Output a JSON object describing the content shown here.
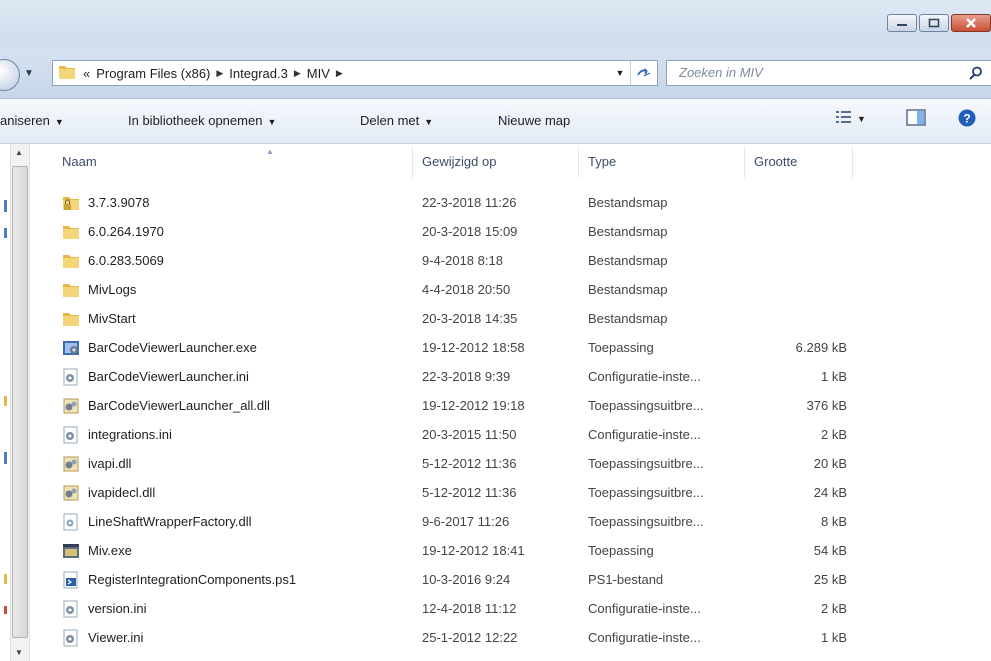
{
  "window": {
    "buttons": [
      "minimize",
      "maximize",
      "close"
    ]
  },
  "address": {
    "overflow": "«",
    "crumbs": [
      "Program Files (x86)",
      "Integrad.3",
      "MIV"
    ],
    "search_placeholder": "Zoeken in MIV"
  },
  "toolbar": {
    "organize": "aniseren",
    "include_library": "In bibliotheek opnemen",
    "share_with": "Delen met",
    "new_folder": "Nieuwe map"
  },
  "columns": {
    "name": "Naam",
    "modified": "Gewijzigd op",
    "type": "Type",
    "size": "Grootte"
  },
  "files": [
    {
      "icon": "locked-folder-icon",
      "name": "3.7.3.9078",
      "modified": "22-3-2018 11:26",
      "type": "Bestandsmap",
      "size": ""
    },
    {
      "icon": "folder-icon",
      "name": "6.0.264.1970",
      "modified": "20-3-2018 15:09",
      "type": "Bestandsmap",
      "size": ""
    },
    {
      "icon": "folder-icon",
      "name": "6.0.283.5069",
      "modified": "9-4-2018 8:18",
      "type": "Bestandsmap",
      "size": ""
    },
    {
      "icon": "folder-icon",
      "name": "MivLogs",
      "modified": "4-4-2018 20:50",
      "type": "Bestandsmap",
      "size": ""
    },
    {
      "icon": "folder-icon",
      "name": "MivStart",
      "modified": "20-3-2018 14:35",
      "type": "Bestandsmap",
      "size": ""
    },
    {
      "icon": "exe-icon",
      "name": "BarCodeViewerLauncher.exe",
      "modified": "19-12-2012 18:58",
      "type": "Toepassing",
      "size": "6.289 kB"
    },
    {
      "icon": "config-file-icon",
      "name": "BarCodeViewerLauncher.ini",
      "modified": "22-3-2018 9:39",
      "type": "Configuratie-inste...",
      "size": "1 kB"
    },
    {
      "icon": "dll-icon",
      "name": "BarCodeViewerLauncher_all.dll",
      "modified": "19-12-2012 19:18",
      "type": "Toepassingsuitbre...",
      "size": "376 kB"
    },
    {
      "icon": "config-file-icon",
      "name": "integrations.ini",
      "modified": "20-3-2015 11:50",
      "type": "Configuratie-inste...",
      "size": "2 kB"
    },
    {
      "icon": "dll-icon",
      "name": "ivapi.dll",
      "modified": "5-12-2012 11:36",
      "type": "Toepassingsuitbre...",
      "size": "20 kB"
    },
    {
      "icon": "dll-icon",
      "name": "ivapidecl.dll",
      "modified": "5-12-2012 11:36",
      "type": "Toepassingsuitbre...",
      "size": "24 kB"
    },
    {
      "icon": "dll-plain-icon",
      "name": "LineShaftWrapperFactory.dll",
      "modified": "9-6-2017 11:26",
      "type": "Toepassingsuitbre...",
      "size": "8 kB"
    },
    {
      "icon": "app-window-icon",
      "name": "Miv.exe",
      "modified": "19-12-2012 18:41",
      "type": "Toepassing",
      "size": "54 kB"
    },
    {
      "icon": "powershell-script-icon",
      "name": "RegisterIntegrationComponents.ps1",
      "modified": "10-3-2016 9:24",
      "type": "PS1-bestand",
      "size": "25 kB"
    },
    {
      "icon": "config-file-icon",
      "name": "version.ini",
      "modified": "12-4-2018 11:12",
      "type": "Configuratie-inste...",
      "size": "2 kB"
    },
    {
      "icon": "config-file-icon",
      "name": "Viewer.ini",
      "modified": "25-1-2012 12:22",
      "type": "Configuratie-inste...",
      "size": "1 kB"
    }
  ],
  "colors": {
    "accent": "#2b62b8",
    "header_text": "#3b4d6a",
    "close_button": "#c74f36"
  }
}
